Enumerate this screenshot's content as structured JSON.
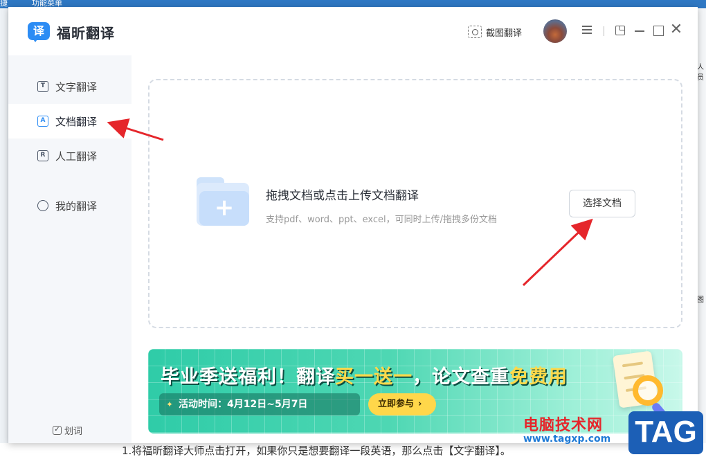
{
  "background": {
    "menu_left": "捷",
    "menu_item": "功能菜单",
    "bottom_text": "1.将福昕翻译大师点击打开，如果你只是想要翻译一段英语，那么点击【文字翻译】。",
    "right_labels": [
      "人员",
      "图"
    ]
  },
  "titlebar": {
    "logo_glyph": "译",
    "app_name": "福昕翻译",
    "screenshot_label": "截图翻译"
  },
  "sidebar": {
    "items": [
      {
        "label": "文字翻译",
        "icon": "T"
      },
      {
        "label": "文档翻译",
        "icon": "A"
      },
      {
        "label": "人工翻译",
        "icon": "R"
      },
      {
        "label": "我的翻译",
        "icon": "person"
      }
    ],
    "active_index": 1,
    "huaci_label": "划词"
  },
  "main": {
    "drop_title": "拖拽文档或点击上传文档翻译",
    "drop_subtitle": "支持pdf、word、ppt、excel，可同时上传/拖拽多份文档",
    "choose_button": "选择文档"
  },
  "banner": {
    "headline_part1": "毕业季送福利！翻译",
    "headline_part2": "买一送一",
    "headline_part3": "，论文查重",
    "headline_part4": "免费用",
    "time_text": "活动时间：4月12日~5月7日",
    "cta": "立即参与"
  },
  "watermark": {
    "cn": "电脑技术网",
    "url": "www.tagxp.com",
    "tag": "TAG"
  },
  "colors": {
    "accent": "#2c8cf4",
    "arrow": "#e5262b",
    "banner_green": "#2fcca8"
  }
}
